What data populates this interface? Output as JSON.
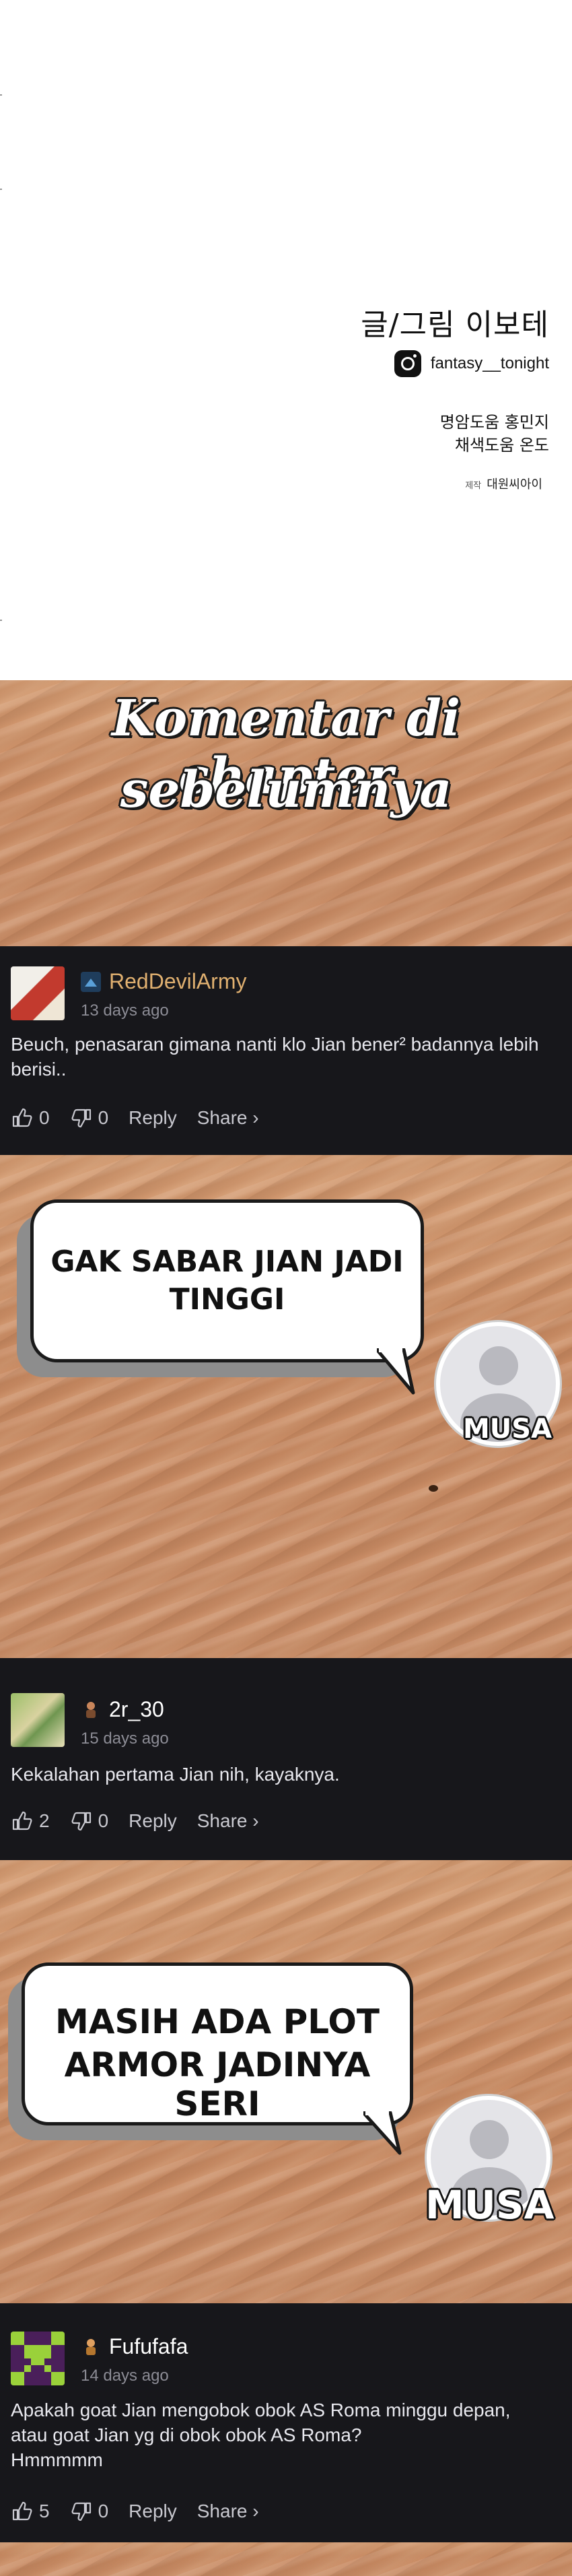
{
  "credits": {
    "title": "글/그림 이보테",
    "instagram_handle": "fantasy__tonight",
    "line1": "명암도움 홍민지",
    "line2": "채색도움 온도",
    "production_label": "제작",
    "production": "대원씨아이"
  },
  "banner": {
    "line1": "Komentar di chapter",
    "line2": "sebelumnya"
  },
  "comments": [
    {
      "username": "RedDevilArmy",
      "username_color": "#e0b070",
      "time": "13 days ago",
      "text": "Beuch, penasaran gimana nanti klo Jian bener² badannya lebih\nberisi..",
      "likes": "0",
      "dislikes": "0",
      "reply": "Reply",
      "share": "Share ›"
    },
    {
      "username": "2r_30",
      "username_color": "#ffffff",
      "time": "15 days ago",
      "text": "Kekalahan pertama Jian nih, kayaknya.",
      "likes": "2",
      "dislikes": "0",
      "reply": "Reply",
      "share": "Share ›"
    },
    {
      "username": "Fufufafa",
      "username_color": "#ffffff",
      "time": "14 days ago",
      "text": "Apakah goat Jian mengobok obok AS Roma minggu depan,\natau goat Jian yg di obok obok AS Roma?\nHmmmmm",
      "likes": "5",
      "dislikes": "0",
      "reply": "Reply",
      "share": "Share ›"
    }
  ],
  "bubbles": [
    {
      "line1": "GAK SABAR JIAN JADI",
      "line2": "TINGGI",
      "speaker": "MUSA"
    },
    {
      "line1": "MASIH ADA PLOT",
      "line2": "ARMOR JADINYA SERI",
      "speaker": "MUSA"
    }
  ]
}
